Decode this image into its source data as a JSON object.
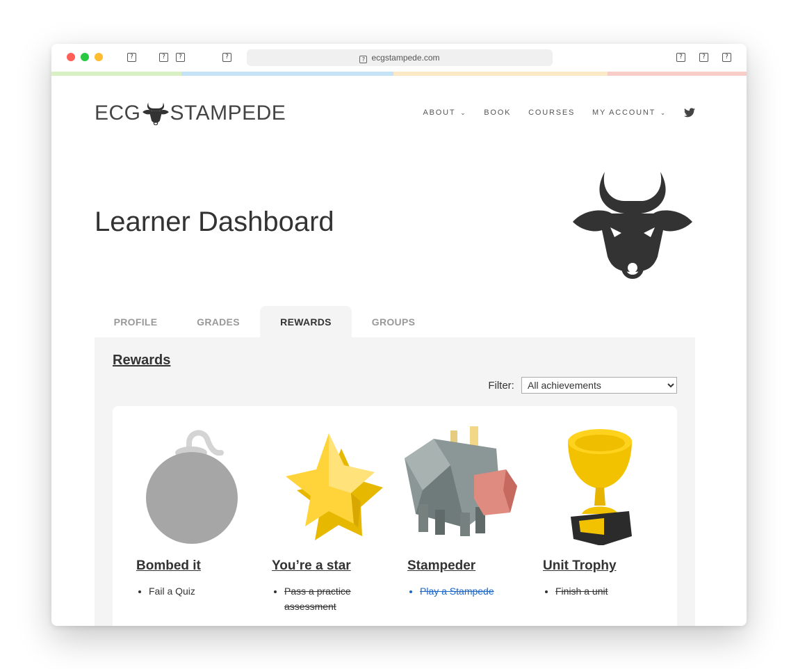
{
  "browser": {
    "url": "ecgstampede.com",
    "strip_colors": [
      "#d8f0c4",
      "#c4e3f7",
      "#fbe8c4",
      "#f8cdc8"
    ]
  },
  "site": {
    "logo_left": "ECG",
    "logo_right": "STAMPEDE",
    "nav": {
      "about": "ABOUT",
      "book": "BOOK",
      "courses": "COURSES",
      "my_account": "MY ACCOUNT"
    }
  },
  "page": {
    "title": "Learner Dashboard"
  },
  "tabs": [
    "PROFILE",
    "GRADES",
    "REWARDS",
    "GROUPS"
  ],
  "active_tab": "REWARDS",
  "rewards": {
    "heading": "Rewards",
    "filter_label": "Filter:",
    "filter_value": "All achievements",
    "cards": [
      {
        "title": "Bombed it",
        "item": "Fail a Quiz",
        "state": "locked"
      },
      {
        "title": "You’re a star",
        "item": "Pass a practice assessment",
        "state": "done"
      },
      {
        "title": "Stampeder",
        "item": "Play a Stampede",
        "state": "link"
      },
      {
        "title": "Unit Trophy",
        "item": "Finish a unit",
        "state": "done"
      }
    ]
  }
}
